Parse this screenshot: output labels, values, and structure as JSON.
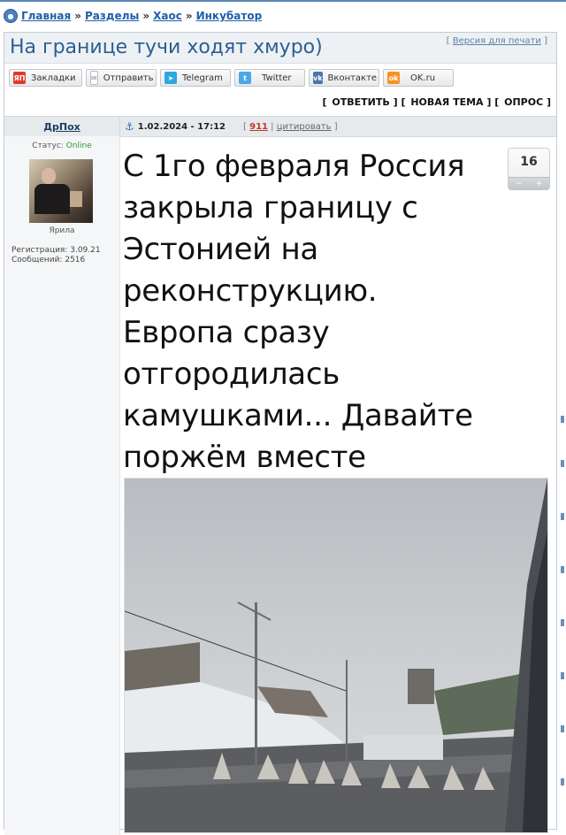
{
  "breadcrumb": {
    "home_icon": "home-icon",
    "items": [
      "Главная",
      "Разделы",
      "Хаос",
      "Инкубатор"
    ],
    "separator": "»"
  },
  "thread": {
    "title": "На границе тучи ходят хмуро)",
    "print_label": "Версия для печати"
  },
  "share": [
    {
      "label": "Закладки",
      "icon": "yandex-icon",
      "icon_text": "ЯП",
      "color": "#e0392b"
    },
    {
      "label": "Отправить",
      "icon": "mail-icon",
      "icon_text": "✉",
      "color": "#9aa3ab"
    },
    {
      "label": "Telegram",
      "icon": "telegram-icon",
      "icon_text": "➤",
      "color": "#2ea6de"
    },
    {
      "label": "Twitter",
      "icon": "twitter-icon",
      "icon_text": "t",
      "color": "#4aa8e8"
    },
    {
      "label": "Вконтакте",
      "icon": "vk-icon",
      "icon_text": "vk",
      "color": "#4a76a8"
    },
    {
      "label": "OK.ru",
      "icon": "ok-icon",
      "icon_text": "ok",
      "color": "#f59322"
    }
  ],
  "actions": [
    "ОТВЕТИТЬ",
    "НОВАЯ ТЕМА",
    "ОПРОС"
  ],
  "post": {
    "author": "ДрПох",
    "date": "1.02.2024 - 17:12",
    "number": "911",
    "quote_label": "цитировать",
    "status_label": "Статус:",
    "status_value": "Online",
    "rank": "Ярила",
    "registration": "Регистрация: 3.09.21",
    "messages": "Сообщений: 2516",
    "text": "С 1го февраля Россия закрыла границу с Эстонией на реконструкцию. Европа сразу отгородилась камушками... Давайте поржём вместе",
    "rating": "16",
    "rating_minus": "−",
    "rating_plus": "+"
  },
  "colors": {
    "link": "#1f5fa6",
    "title": "#2b5e93",
    "online": "#2d9a2d",
    "post_number": "#c0392b"
  }
}
